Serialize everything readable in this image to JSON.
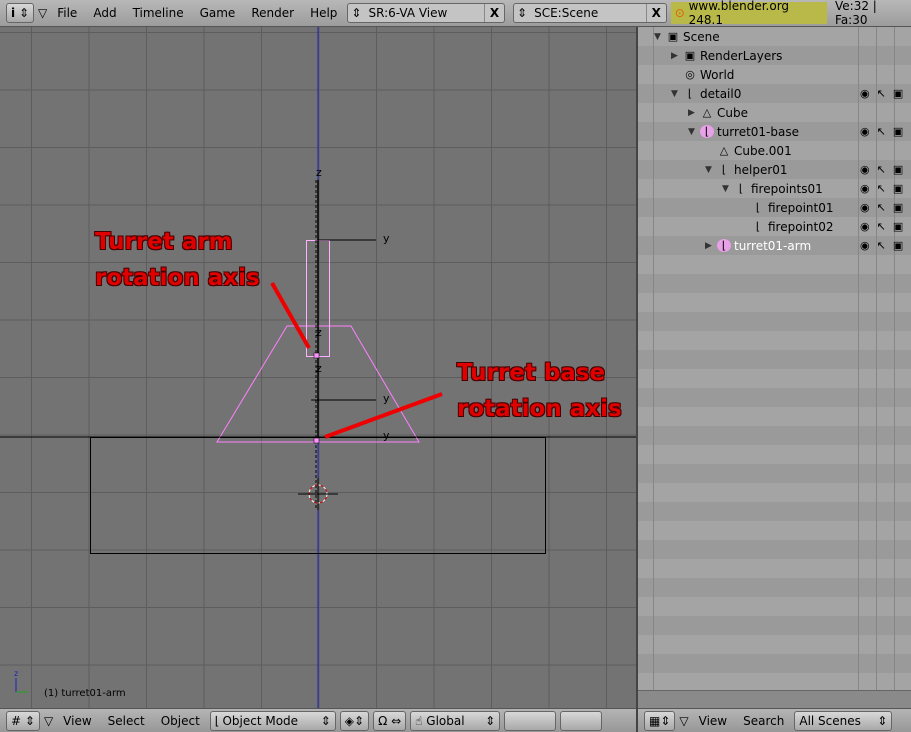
{
  "top_header": {
    "menus": [
      "File",
      "Add",
      "Timeline",
      "Game",
      "Render",
      "Help"
    ],
    "screen": "SR:6-VA View",
    "scene": "SCE:Scene",
    "version": "www.blender.org 248.1",
    "stats": "Ve:32 | Fa:30"
  },
  "viewport": {
    "active_object": "(1) turret01-arm",
    "axis_label_z": "z",
    "axis_label_y": "y",
    "annotations": [
      "Turret arm\nrotation axis",
      "Turret base\nrotation axis"
    ],
    "colors": {
      "selected": "#ff80ff",
      "z_axis": "#2020c0",
      "annotation": "#e00000"
    }
  },
  "outliner": {
    "items": [
      {
        "label": "Scene",
        "icon": "scene-icon",
        "expanded": true,
        "flags": false
      },
      {
        "label": "RenderLayers",
        "icon": "renderlayers-icon",
        "expanded": false,
        "flags": false
      },
      {
        "label": "World",
        "icon": "world-icon",
        "flags": false
      },
      {
        "label": "detail0",
        "icon": "empty-icon",
        "expanded": true,
        "flags": true
      },
      {
        "label": "Cube",
        "icon": "mesh-icon",
        "expanded": false,
        "flags": false
      },
      {
        "label": "turret01-base",
        "icon": "empty-icon",
        "expanded": true,
        "flags": true
      },
      {
        "label": "Cube.001",
        "icon": "mesh-icon",
        "flags": false
      },
      {
        "label": "helper01",
        "icon": "empty-icon",
        "expanded": true,
        "flags": true
      },
      {
        "label": "firepoints01",
        "icon": "empty-icon",
        "expanded": true,
        "flags": true
      },
      {
        "label": "firepoint01",
        "icon": "empty-icon",
        "flags": true
      },
      {
        "label": "firepoint02",
        "icon": "empty-icon",
        "flags": true
      },
      {
        "label": "turret01-arm",
        "icon": "empty-icon",
        "expanded": false,
        "flags": true
      }
    ]
  },
  "view3d_header": {
    "menus": [
      "View",
      "Select",
      "Object"
    ],
    "mode": "Object Mode",
    "orientation": "Global"
  },
  "outliner_header": {
    "menus": [
      "View",
      "Search"
    ],
    "filter": "All Scenes"
  }
}
